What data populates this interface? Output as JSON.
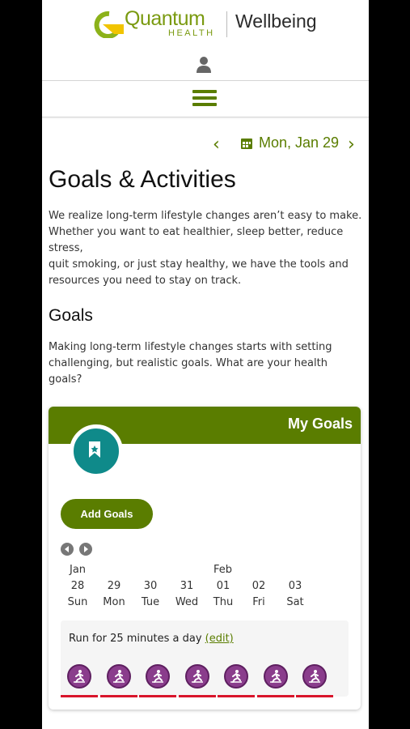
{
  "header": {
    "logo_word": "Quantum",
    "logo_sub": "HEALTH",
    "brand": "Wellbeing"
  },
  "icons": {
    "user": "user-icon",
    "menu": "hamburger-menu-icon",
    "prev": "chevron-left-icon",
    "next": "chevron-right-icon",
    "calendar": "calendar-icon",
    "badge": "bookmark-icon",
    "activity": "running-icon"
  },
  "date_nav": {
    "prev": "‹",
    "next": "›",
    "date": "Mon, Jan 29"
  },
  "page": {
    "title": "Goals & Activities",
    "intro_lines": [
      "We realize long-term lifestyle changes aren’t easy to make.",
      "Whether you want to eat healthier, sleep better, reduce stress,",
      "quit smoking, or just stay healthy, we have the tools and",
      "resources you need to stay on track."
    ],
    "goals_heading": "Goals",
    "goals_lines": [
      "Making long-term lifestyle changes starts with setting",
      "challenging, but realistic goals. What are your health goals?"
    ]
  },
  "card": {
    "title": "My Goals",
    "add_label": "Add Goals",
    "months": [
      "Jan",
      "Feb"
    ],
    "days": [
      {
        "date": "28",
        "day": "Sun"
      },
      {
        "date": "29",
        "day": "Mon"
      },
      {
        "date": "30",
        "day": "Tue"
      },
      {
        "date": "31",
        "day": "Wed"
      },
      {
        "date": "01",
        "day": "Thu"
      },
      {
        "date": "02",
        "day": "Fri"
      },
      {
        "date": "03",
        "day": "Sat"
      }
    ],
    "goal_text": "Run for 25 minutes a day",
    "goal_edit": "(edit)"
  },
  "colors": {
    "brand_green": "#5a7d00",
    "badge_teal": "#0f8a8a",
    "activity_purple": "#8a3d8c",
    "underline_red": "#d8142a"
  }
}
